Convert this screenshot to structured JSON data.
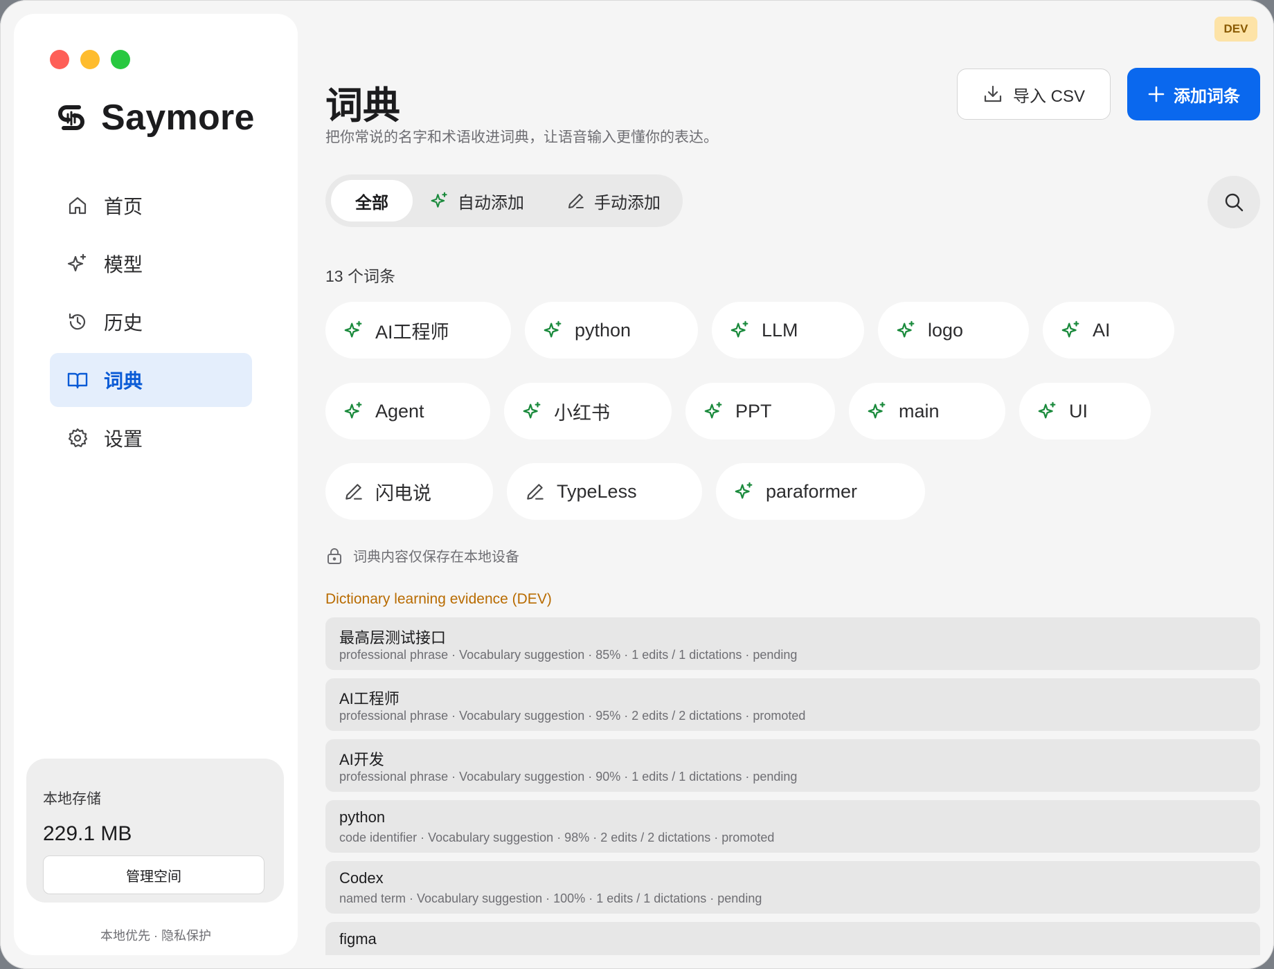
{
  "app": {
    "name": "Saymore",
    "dev_badge": "DEV",
    "traffic_colors": [
      "#fe5f57",
      "#febc2e",
      "#28c840"
    ]
  },
  "sidebar": {
    "items": [
      {
        "label": "首页",
        "icon": "home-icon",
        "active": false
      },
      {
        "label": "模型",
        "icon": "sparkle-icon",
        "active": false
      },
      {
        "label": "历史",
        "icon": "history-icon",
        "active": false
      },
      {
        "label": "词典",
        "icon": "book-icon",
        "active": true
      },
      {
        "label": "设置",
        "icon": "gear-icon",
        "active": false
      }
    ],
    "storage": {
      "title": "本地存储",
      "size": "229.1 MB",
      "manage_label": "管理空间"
    },
    "footer": "本地优先 · 隐私保护"
  },
  "main": {
    "title": "词典",
    "subtitle": "把你常说的名字和术语收进词典，让语音输入更懂你的表达。",
    "import_label": "导入 CSV",
    "add_label": "添加词条",
    "tabs": [
      {
        "label": "全部",
        "icon": "",
        "active": true
      },
      {
        "label": "自动添加",
        "icon": "sparkle-icon",
        "active": false
      },
      {
        "label": "手动添加",
        "icon": "pencil-icon",
        "active": false
      }
    ],
    "count_label": "13 个词条",
    "terms": [
      {
        "label": "AI工程师",
        "source": "auto"
      },
      {
        "label": "python",
        "source": "auto"
      },
      {
        "label": "LLM",
        "source": "auto"
      },
      {
        "label": "logo",
        "source": "auto"
      },
      {
        "label": "AI",
        "source": "auto"
      },
      {
        "label": "Agent",
        "source": "auto"
      },
      {
        "label": "小红书",
        "source": "auto"
      },
      {
        "label": "PPT",
        "source": "auto"
      },
      {
        "label": "main",
        "source": "auto"
      },
      {
        "label": "UI",
        "source": "auto"
      },
      {
        "label": "闪电说",
        "source": "manual"
      },
      {
        "label": "TypeLess",
        "source": "manual"
      },
      {
        "label": "paraformer",
        "source": "auto"
      }
    ],
    "local_note": "词典内容仅保存在本地设备",
    "evidence_title": "Dictionary learning evidence (DEV)",
    "evidence": [
      {
        "term": "最高层测试接口",
        "meta": "professional phrase · Vocabulary suggestion · 85% · 1 edits / 1 dictations · pending"
      },
      {
        "term": "AI工程师",
        "meta": "professional phrase · Vocabulary suggestion · 95% · 2 edits / 2 dictations · promoted"
      },
      {
        "term": "AI开发",
        "meta": "professional phrase · Vocabulary suggestion · 90% · 1 edits / 1 dictations · pending"
      },
      {
        "term": "python",
        "meta": "code identifier · Vocabulary suggestion · 98% · 2 edits / 2 dictations · promoted"
      },
      {
        "term": "Codex",
        "meta": "named term · Vocabulary suggestion · 100% · 1 edits / 1 dictations · pending"
      },
      {
        "term": "figma",
        "meta": ""
      }
    ],
    "colors": {
      "accent": "#0a68ee",
      "auto_icon": "#1a8a3c",
      "dev": "#b86b00"
    }
  }
}
